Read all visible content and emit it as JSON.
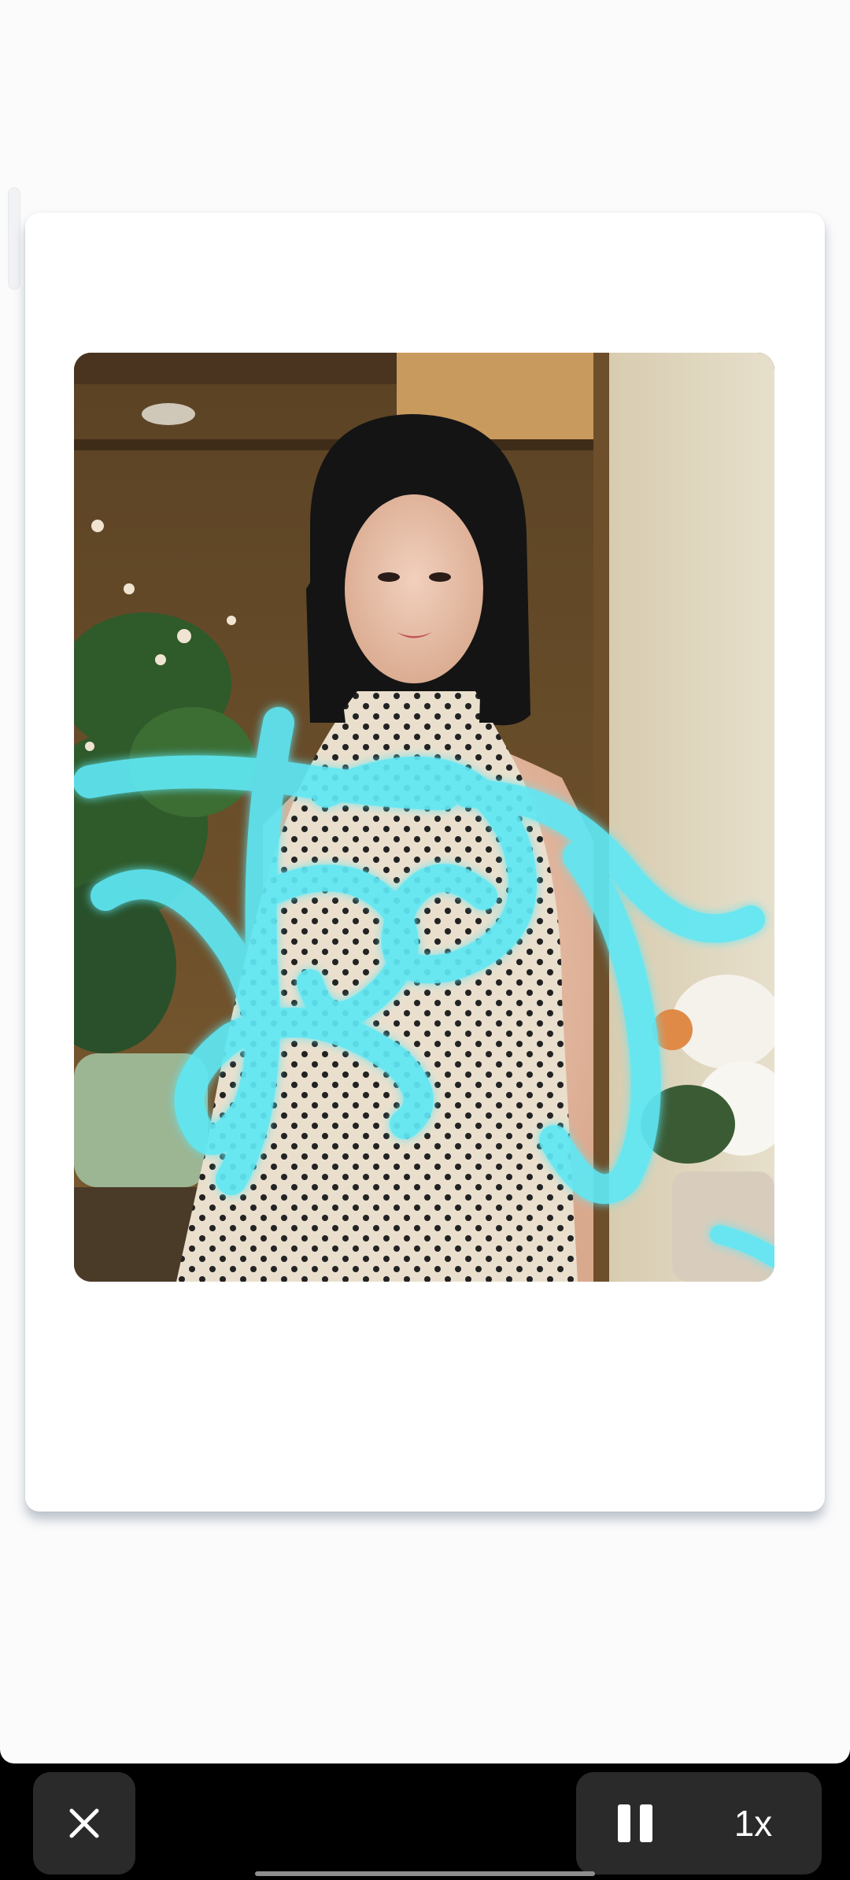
{
  "viewer": {
    "photo_icon": "photocard-image",
    "signature_color": "#5fe8f5"
  },
  "controls": {
    "close_icon": "close-icon",
    "pause_icon": "pause-icon",
    "speed_label": "1x"
  }
}
